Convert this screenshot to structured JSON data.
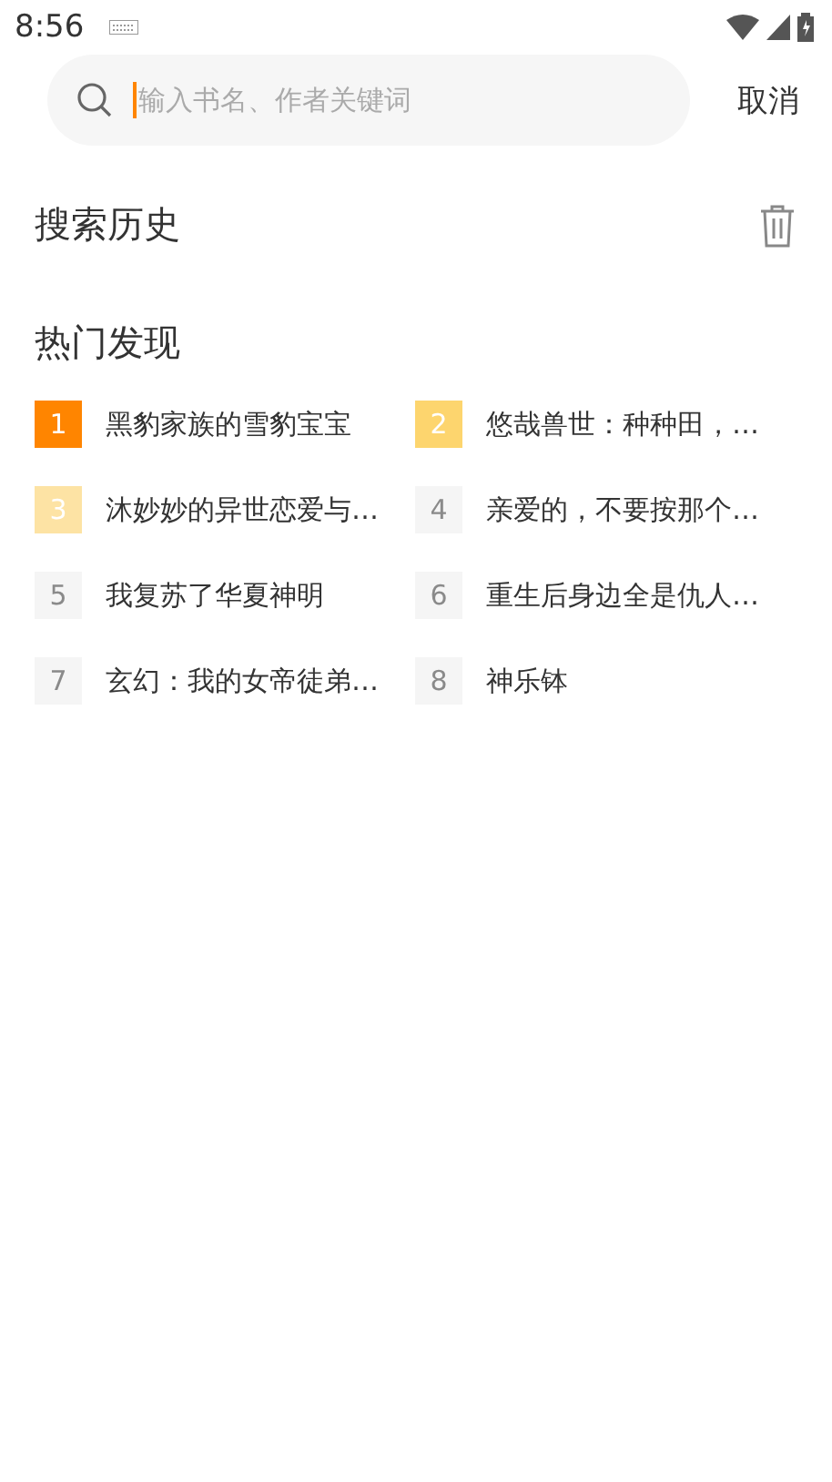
{
  "status_bar": {
    "time": "8:56"
  },
  "search": {
    "placeholder": "输入书名、作者关键词",
    "cancel": "取消"
  },
  "history": {
    "title": "搜索历史"
  },
  "hot": {
    "title": "热门发现",
    "items": [
      {
        "rank": "1",
        "title": "黑豹家族的雪豹宝宝",
        "color": "#ff8500"
      },
      {
        "rank": "2",
        "title": "悠哉兽世：种种田，…",
        "color": "#fdd56e"
      },
      {
        "rank": "3",
        "title": "沐妙妙的异世恋爱与…",
        "color": "#fde3a4"
      },
      {
        "rank": "4",
        "title": "亲爱的，不要按那个…",
        "color": "#f5f5f5"
      },
      {
        "rank": "5",
        "title": "我复苏了华夏神明",
        "color": "#f5f5f5"
      },
      {
        "rank": "6",
        "title": "重生后身边全是仇人…",
        "color": "#f5f5f5"
      },
      {
        "rank": "7",
        "title": "玄幻：我的女帝徒弟…",
        "color": "#f5f5f5"
      },
      {
        "rank": "8",
        "title": "神乐钵",
        "color": "#f5f5f5"
      }
    ]
  }
}
